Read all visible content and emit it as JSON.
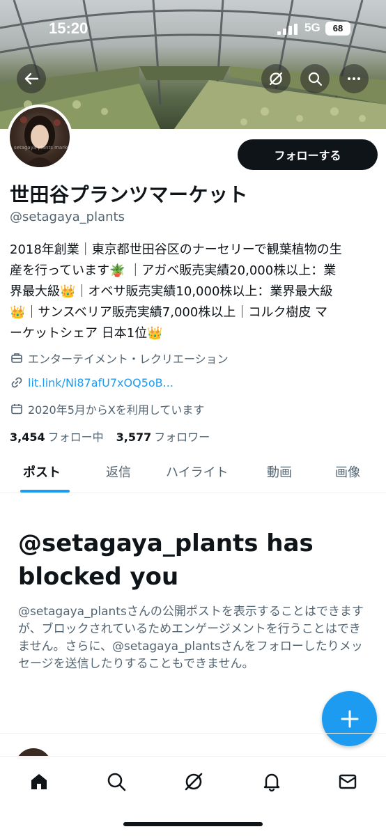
{
  "status_bar": {
    "time": "15:20",
    "network": "5G",
    "battery": "68"
  },
  "profile": {
    "name": "世田谷プランツマーケット",
    "handle": "@setagaya_plants",
    "avatar_watermark": "setagaya plants market",
    "follow_label": "フォローする",
    "bio_lines": [
      "2018年創業｜東京都世田谷区のナーセリーで観葉植物の生",
      "産を行っています🪴 ｜アガベ販売実績20,000株以上：業",
      "界最大級👑｜オベサ販売実績10,000株以上：業界最大級",
      "👑｜サンスベリア販売実績7,000株以上｜コルク樹皮 マ",
      "ーケットシェア 日本1位👑"
    ],
    "category": "エンターテイメント・レクリエーション",
    "link": "lit.link/Ni87afU7xOQ5oB...",
    "joined": "2020年5月からXを利用しています",
    "following_count": "3,454",
    "following_label": "フォロー中",
    "followers_count": "3,577",
    "followers_label": "フォロワー"
  },
  "tabs": [
    "ポスト",
    "返信",
    "ハイライト",
    "動画",
    "画像"
  ],
  "blocked": {
    "title": "@setagaya_plants has blocked you",
    "description": "@setagaya_plantsさんの公開ポストを表示することはできますが、ブロックされているためエンゲージメントを行うことはできません。さらに、@setagaya_plantsさんをフォローしたりメッセージを送信したりすることもできません。"
  },
  "colors": {
    "accent": "#1d9bf0",
    "text": "#0f1419",
    "secondary": "#536471"
  },
  "icons": {
    "header": [
      "back-arrow-icon",
      "grok-icon",
      "search-icon",
      "more-icon"
    ],
    "nav": [
      "home-icon",
      "search-icon",
      "grok-icon",
      "notifications-icon",
      "messages-icon"
    ]
  }
}
